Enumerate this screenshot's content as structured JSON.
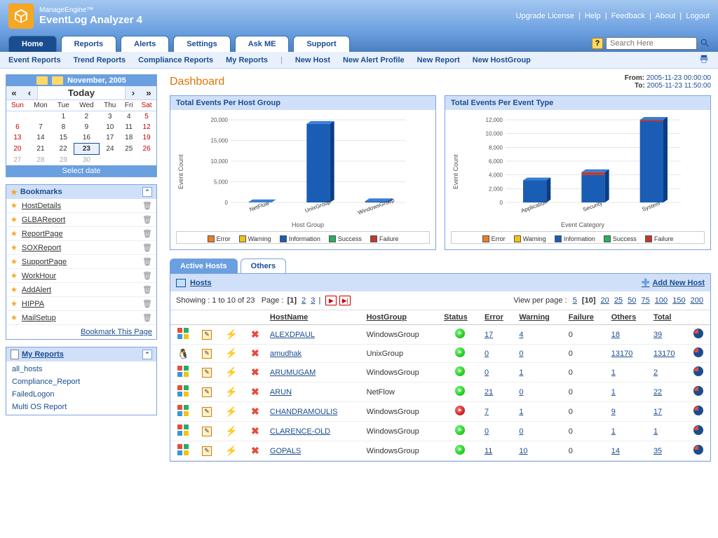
{
  "brand": {
    "top": "ManageEngine™",
    "bottom": "EventLog Analyzer 4"
  },
  "top_links": [
    "Upgrade License",
    "Help",
    "Feedback",
    "About",
    "Logout"
  ],
  "tabs": [
    "Home",
    "Reports",
    "Alerts",
    "Settings",
    "Ask ME",
    "Support"
  ],
  "active_tab": 0,
  "search": {
    "placeholder": "Search Here"
  },
  "subnav_left": [
    "Event Reports",
    "Trend Reports",
    "Compliance Reports",
    "My Reports"
  ],
  "subnav_right": [
    "New Host",
    "New Alert Profile",
    "New Report",
    "New HostGroup"
  ],
  "calendar": {
    "title": "November, 2005",
    "today_label": "Today",
    "select_label": "Select date",
    "days": [
      "Sun",
      "Mon",
      "Tue",
      "Wed",
      "Thu",
      "Fri",
      "Sat"
    ],
    "weeks": [
      [
        {
          "d": "",
          "o": 1
        },
        {
          "d": "",
          "o": 1
        },
        {
          "d": "1"
        },
        {
          "d": "2"
        },
        {
          "d": "3"
        },
        {
          "d": "4"
        },
        {
          "d": "5"
        }
      ],
      [
        {
          "d": "6"
        },
        {
          "d": "7"
        },
        {
          "d": "8"
        },
        {
          "d": "9"
        },
        {
          "d": "10"
        },
        {
          "d": "11"
        },
        {
          "d": "12"
        }
      ],
      [
        {
          "d": "13"
        },
        {
          "d": "14"
        },
        {
          "d": "15"
        },
        {
          "d": "16"
        },
        {
          "d": "17"
        },
        {
          "d": "18"
        },
        {
          "d": "19"
        }
      ],
      [
        {
          "d": "20"
        },
        {
          "d": "21"
        },
        {
          "d": "22"
        },
        {
          "d": "23",
          "t": 1
        },
        {
          "d": "24"
        },
        {
          "d": "25"
        },
        {
          "d": "26"
        }
      ],
      [
        {
          "d": "27",
          "o": 1
        },
        {
          "d": "28",
          "o": 1
        },
        {
          "d": "29",
          "o": 1
        },
        {
          "d": "30",
          "o": 1
        },
        {
          "d": ""
        },
        {
          "d": ""
        },
        {
          "d": ""
        }
      ]
    ]
  },
  "bookmarks": {
    "title": "Bookmarks",
    "items": [
      "HostDetails",
      "GLBAReport",
      "ReportPage",
      "SOXReport",
      "SupportPage",
      "WorkHour",
      "AddAlert",
      "HIPPA",
      "MailSetup"
    ],
    "link": "Bookmark This Page"
  },
  "my_reports": {
    "title": "My Reports",
    "items": [
      "all_hosts",
      "Compliance_Report",
      "FailedLogon",
      "Multi OS Report"
    ]
  },
  "dashboard": {
    "title": "Dashboard",
    "from_label": "From:",
    "from_value": "2005-11-23 00:00:00",
    "to_label": "To:",
    "to_value": "2005-11-23 11:50:00"
  },
  "chart_data": [
    {
      "type": "bar",
      "title": "Total Events Per Host Group",
      "ylabel": "Event Count",
      "xlabel": "Host Group",
      "categories": [
        "NetFlow",
        "UnixGroup",
        "WindowsGroup"
      ],
      "series": [
        {
          "name": "Error",
          "color": "#e67e22"
        },
        {
          "name": "Warning",
          "color": "#f1c40f"
        },
        {
          "name": "Information",
          "color": "#1a5db5"
        },
        {
          "name": "Success",
          "color": "#27ae60"
        },
        {
          "name": "Failure",
          "color": "#c0392b"
        }
      ],
      "values": [
        50,
        19000,
        300
      ],
      "ylim": [
        0,
        20000
      ],
      "yticks": [
        0,
        5000,
        10000,
        15000,
        20000
      ]
    },
    {
      "type": "bar",
      "title": "Total Events Per Event Type",
      "ylabel": "Event Count",
      "xlabel": "Event Category",
      "categories": [
        "Application",
        "Security",
        "System"
      ],
      "series": [
        {
          "name": "Error",
          "color": "#e67e22"
        },
        {
          "name": "Warning",
          "color": "#f1c40f"
        },
        {
          "name": "Information",
          "color": "#1a5db5"
        },
        {
          "name": "Success",
          "color": "#27ae60"
        },
        {
          "name": "Failure",
          "color": "#c0392b"
        }
      ],
      "stacks": [
        {
          "info": 3200,
          "error": 0
        },
        {
          "info": 4000,
          "error": 400
        },
        {
          "info": 11800,
          "error": 200
        }
      ],
      "ylim": [
        0,
        12000
      ],
      "yticks": [
        0,
        2000,
        4000,
        6000,
        8000,
        10000,
        12000
      ]
    }
  ],
  "hosts": {
    "tabs": [
      "Active Hosts",
      "Others"
    ],
    "active_tab": 0,
    "section_title": "Hosts",
    "add_label": "Add New Host",
    "showing": "Showing : 1 to 10 of 23",
    "page_label": "Page :",
    "pages": [
      "[1]",
      "2",
      "3"
    ],
    "view_label": "View per page :",
    "view_options": [
      "5",
      "[10]",
      "20",
      "25",
      "50",
      "75",
      "100",
      "150",
      "200"
    ],
    "columns": [
      "HostName",
      "HostGroup",
      "Status",
      "Error",
      "Warning",
      "Failure",
      "Others",
      "Total"
    ],
    "rows": [
      {
        "os": "win",
        "name": "ALEXDPAUL",
        "group": "WindowsGroup",
        "status": "green",
        "error": "17",
        "warning": "4",
        "failure": "0",
        "others": "18",
        "total": "39"
      },
      {
        "os": "linux",
        "name": "amudhak",
        "group": "UnixGroup",
        "status": "green",
        "error": "0",
        "warning": "0",
        "failure": "0",
        "others": "13170",
        "total": "13170"
      },
      {
        "os": "win",
        "name": "ARUMUGAM",
        "group": "WindowsGroup",
        "status": "green",
        "error": "0",
        "warning": "1",
        "failure": "0",
        "others": "1",
        "total": "2"
      },
      {
        "os": "win",
        "name": "ARUN",
        "group": "NetFlow",
        "status": "green",
        "error": "21",
        "warning": "0",
        "failure": "0",
        "others": "1",
        "total": "22"
      },
      {
        "os": "win",
        "name": "CHANDRAMOULIS",
        "group": "WindowsGroup",
        "status": "red",
        "error": "7",
        "warning": "1",
        "failure": "0",
        "others": "9",
        "total": "17"
      },
      {
        "os": "win",
        "name": "CLARENCE-OLD",
        "group": "WindowsGroup",
        "status": "green",
        "error": "0",
        "warning": "0",
        "failure": "0",
        "others": "1",
        "total": "1"
      },
      {
        "os": "win",
        "name": "GOPALS",
        "group": "WindowsGroup",
        "status": "green",
        "error": "11",
        "warning": "10",
        "failure": "0",
        "others": "14",
        "total": "35"
      }
    ]
  }
}
